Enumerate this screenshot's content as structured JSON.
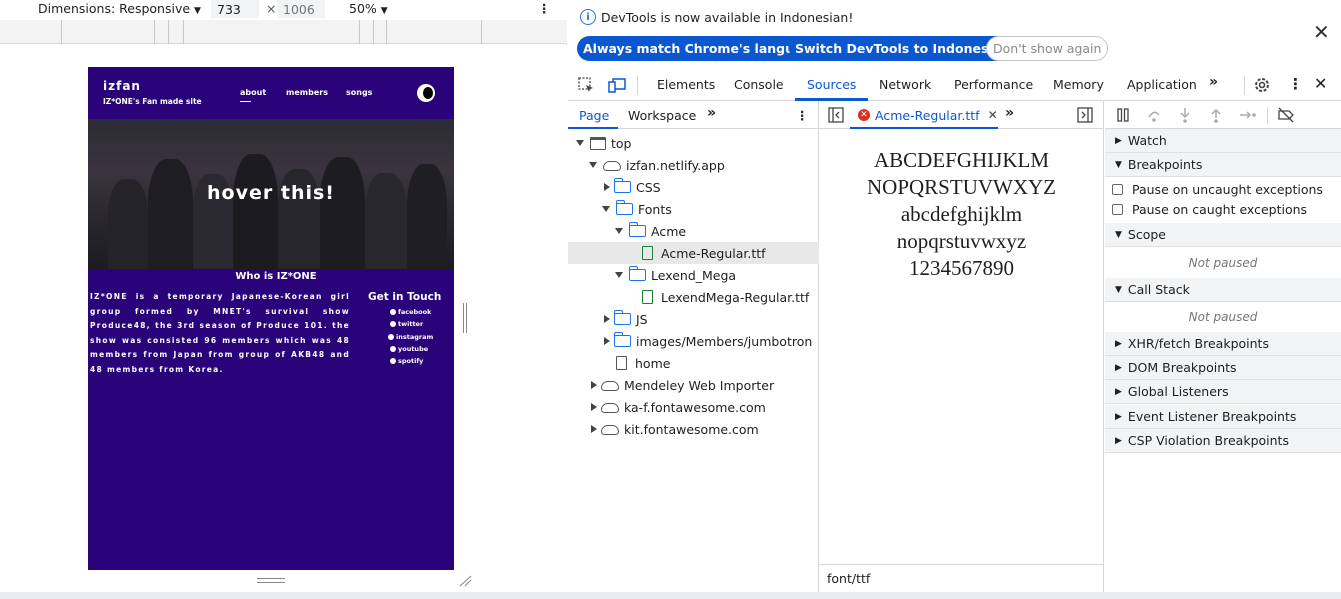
{
  "device_toolbar": {
    "dimensions_label": "Dimensions: Responsive",
    "width": "733",
    "times": "×",
    "height_placeholder": "1006",
    "zoom": "50%"
  },
  "site": {
    "logo": "izfan",
    "subtitle": "IZ*ONE's Fan made site",
    "nav": [
      "about",
      "members",
      "songs"
    ],
    "hero_text": "hover this!",
    "who_title": "Who is IZ*ONE",
    "who_text": "IZ*ONE is a temporary Japanese-Korean girl group formed by MNET's survival show Produce48, the 3rd season of Produce 101. the show was consisted 96 members which was 48 members from Japan from group of AKB48 and 48 members from Korea.",
    "contact_title": "Get in Touch",
    "socials": [
      "facebook",
      "twitter",
      "instagram",
      "youtube",
      "spotify"
    ]
  },
  "infobar": {
    "message": "DevTools is now available in Indonesian!",
    "buttons": [
      "Always match Chrome's language",
      "Switch DevTools to Indonesian",
      "Don't show again"
    ]
  },
  "devtools_tabs": [
    "Elements",
    "Console",
    "Sources",
    "Network",
    "Performance",
    "Memory",
    "Application"
  ],
  "active_tab": "Sources",
  "navigator": {
    "tabs": [
      "Page",
      "Workspace"
    ],
    "tree": [
      {
        "label": "top",
        "kind": "frame",
        "state": "open",
        "depth": 0
      },
      {
        "label": "izfan.netlify.app",
        "kind": "cloud",
        "state": "open",
        "depth": 1
      },
      {
        "label": "CSS",
        "kind": "folder",
        "state": "closed",
        "depth": 2
      },
      {
        "label": "Fonts",
        "kind": "folder",
        "state": "open",
        "depth": 2
      },
      {
        "label": "Acme",
        "kind": "folder",
        "state": "open",
        "depth": 3
      },
      {
        "label": "Acme-Regular.ttf",
        "kind": "font-file",
        "state": "leaf",
        "depth": 4,
        "selected": true
      },
      {
        "label": "Lexend_Mega",
        "kind": "folder",
        "state": "open",
        "depth": 3
      },
      {
        "label": "LexendMega-Regular.ttf",
        "kind": "font-file",
        "state": "leaf",
        "depth": 4
      },
      {
        "label": "JS",
        "kind": "folder",
        "state": "closed",
        "depth": 2
      },
      {
        "label": "images/Members/jumbotron",
        "kind": "folder",
        "state": "closed",
        "depth": 2
      },
      {
        "label": "home",
        "kind": "file",
        "state": "leaf",
        "depth": 2
      },
      {
        "label": "Mendeley Web Importer",
        "kind": "cloud",
        "state": "closed",
        "depth": 1
      },
      {
        "label": "ka-f.fontawesome.com",
        "kind": "cloud",
        "state": "closed",
        "depth": 1
      },
      {
        "label": "kit.fontawesome.com",
        "kind": "cloud",
        "state": "closed",
        "depth": 1
      }
    ]
  },
  "editor": {
    "open_file": "Acme-Regular.ttf",
    "preview_lines": [
      "ABCDEFGHIJKLM",
      "NOPQRSTUVWXYZ",
      "abcdefghijklm",
      "nopqrstuvwxyz",
      "1234567890"
    ],
    "status": "font/ttf"
  },
  "debugger": {
    "sections": {
      "watch": "Watch",
      "breakpoints": "Breakpoints",
      "pause_uncaught": "Pause on uncaught exceptions",
      "pause_caught": "Pause on caught exceptions",
      "scope": "Scope",
      "scope_state": "Not paused",
      "call_stack": "Call Stack",
      "call_stack_state": "Not paused",
      "xhr": "XHR/fetch Breakpoints",
      "dom": "DOM Breakpoints",
      "global": "Global Listeners",
      "event": "Event Listener Breakpoints",
      "csp": "CSP Violation Breakpoints"
    }
  },
  "colors": {
    "accent": "#0b57d0",
    "site_bg": "#2a037a",
    "error": "#d93025",
    "font_file": "#188038"
  }
}
